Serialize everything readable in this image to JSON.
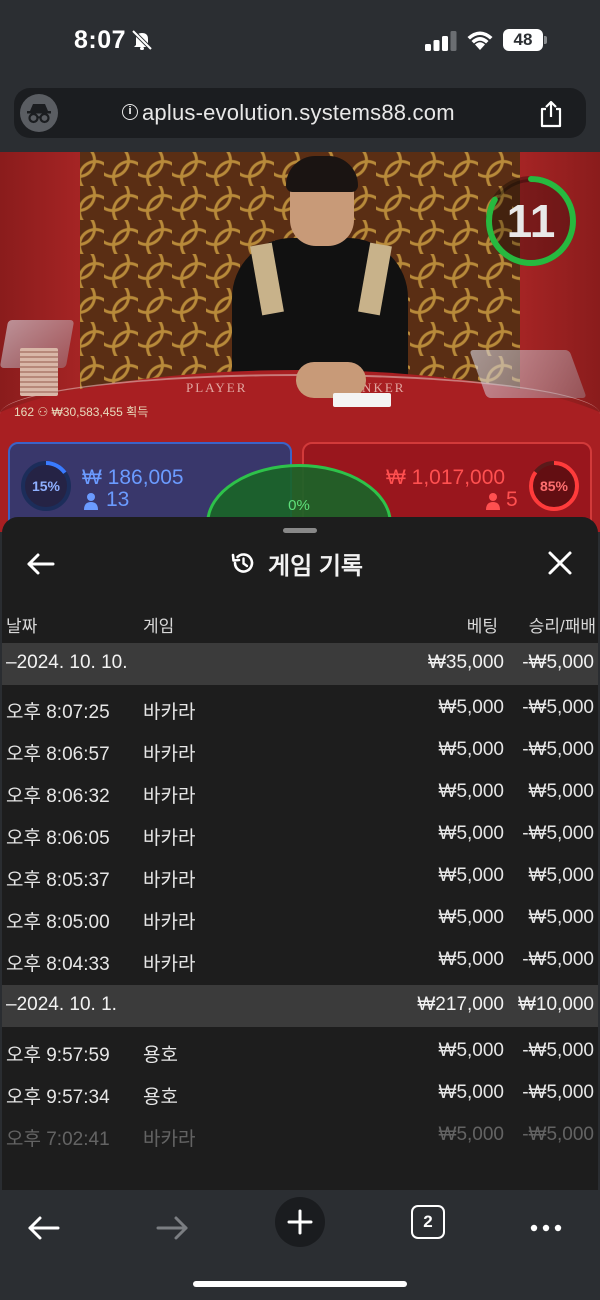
{
  "status_bar": {
    "time": "8:07",
    "battery": "48"
  },
  "browser": {
    "url": "aplus-evolution.systems88.com",
    "tab_count": "2"
  },
  "game": {
    "timer": "11",
    "players_info": "162 ⚇ ₩30,583,455 획득",
    "table_player_label": "PLAYER",
    "table_banker_label": "BANKER",
    "player": {
      "percent": "15%",
      "amount": "₩ 186,005",
      "count": "13",
      "color": "#3a63c8"
    },
    "banker": {
      "percent": "85%",
      "amount": "₩ 1,017,000",
      "count": "5",
      "color": "#d23a3a"
    },
    "tie": {
      "percent": "0%",
      "color": "#2ec24a"
    },
    "timer_color": "#27b93f"
  },
  "history": {
    "title": "게임 기록",
    "columns": {
      "date": "날짜",
      "game": "게임",
      "bet": "베팅",
      "result": "승리/패배"
    },
    "groups": [
      {
        "date": "–2024. 10. 10.",
        "bet": "₩35,000",
        "result": "-₩5,000",
        "rows": [
          {
            "time": "오후 8:07:25",
            "game": "바카라",
            "bet": "₩5,000",
            "result": "-₩5,000"
          },
          {
            "time": "오후 8:06:57",
            "game": "바카라",
            "bet": "₩5,000",
            "result": "-₩5,000"
          },
          {
            "time": "오후 8:06:32",
            "game": "바카라",
            "bet": "₩5,000",
            "result": "₩5,000"
          },
          {
            "time": "오후 8:06:05",
            "game": "바카라",
            "bet": "₩5,000",
            "result": "-₩5,000"
          },
          {
            "time": "오후 8:05:37",
            "game": "바카라",
            "bet": "₩5,000",
            "result": "₩5,000"
          },
          {
            "time": "오후 8:05:00",
            "game": "바카라",
            "bet": "₩5,000",
            "result": "₩5,000"
          },
          {
            "time": "오후 8:04:33",
            "game": "바카라",
            "bet": "₩5,000",
            "result": "-₩5,000"
          }
        ]
      },
      {
        "date": "–2024. 10. 1.",
        "bet": "₩217,000",
        "result": "₩10,000",
        "rows": [
          {
            "time": "오후 9:57:59",
            "game": "용호",
            "bet": "₩5,000",
            "result": "-₩5,000"
          },
          {
            "time": "오후 9:57:34",
            "game": "용호",
            "bet": "₩5,000",
            "result": "-₩5,000"
          },
          {
            "time": "오후 7:02:41",
            "game": "바카라",
            "bet": "₩5,000",
            "result": "-₩5,000"
          }
        ]
      }
    ]
  },
  "icons": {
    "status": [
      "bell-slash-icon",
      "cellular-signal-icon",
      "wifi-icon",
      "battery-icon"
    ],
    "browser": [
      "incognito-icon",
      "info-icon",
      "share-icon"
    ],
    "sheet": [
      "back-arrow-icon",
      "history-icon",
      "close-icon"
    ],
    "toolbar": [
      "back-icon",
      "forward-icon",
      "new-tab-icon",
      "tabs-icon",
      "more-icon"
    ]
  }
}
